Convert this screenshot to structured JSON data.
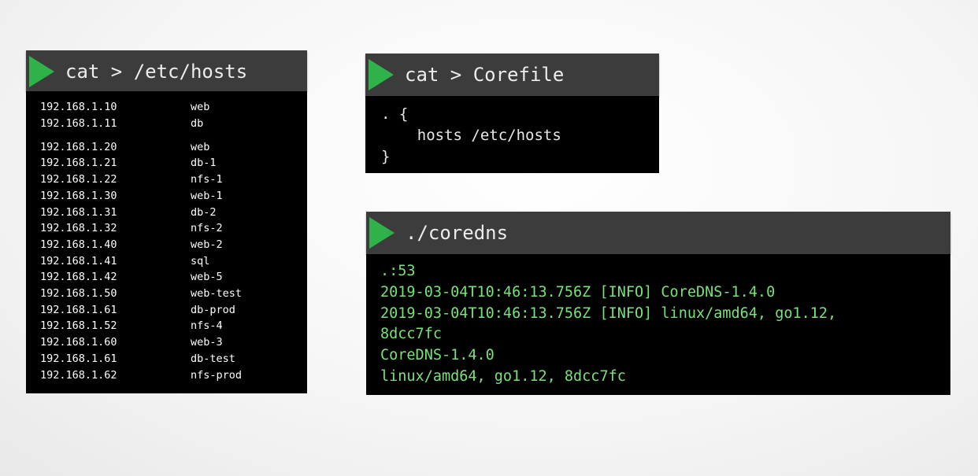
{
  "hosts_panel": {
    "command": "cat > /etc/hosts",
    "entries": [
      {
        "ip": "192.168.1.10",
        "name": "web"
      },
      {
        "ip": "192.168.1.11",
        "name": "db"
      },
      {
        "ip": "192.168.1.20",
        "name": "web"
      },
      {
        "ip": "192.168.1.21",
        "name": "db-1"
      },
      {
        "ip": "192.168.1.22",
        "name": "nfs-1"
      },
      {
        "ip": "192.168.1.30",
        "name": "web-1"
      },
      {
        "ip": "192.168.1.31",
        "name": "db-2"
      },
      {
        "ip": "192.168.1.32",
        "name": "nfs-2"
      },
      {
        "ip": "192.168.1.40",
        "name": "web-2"
      },
      {
        "ip": "192.168.1.41",
        "name": "sql"
      },
      {
        "ip": "192.168.1.42",
        "name": "web-5"
      },
      {
        "ip": "192.168.1.50",
        "name": "web-test"
      },
      {
        "ip": "192.168.1.61",
        "name": "db-prod"
      },
      {
        "ip": "192.168.1.52",
        "name": "nfs-4"
      },
      {
        "ip": "192.168.1.60",
        "name": "web-3"
      },
      {
        "ip": "192.168.1.61",
        "name": "db-test"
      },
      {
        "ip": "192.168.1.62",
        "name": "nfs-prod"
      }
    ]
  },
  "corefile_panel": {
    "command": "cat > Corefile",
    "lines": [
      ". {",
      "    hosts /etc/hosts",
      "}"
    ]
  },
  "coredns_panel": {
    "command": "./coredns",
    "output": [
      ".:53",
      "2019-03-04T10:46:13.756Z [INFO] CoreDNS-1.4.0",
      "2019-03-04T10:46:13.756Z [INFO] linux/amd64, go1.12,",
      "8dcc7fc",
      "CoreDNS-1.4.0",
      "linux/amd64, go1.12, 8dcc7fc"
    ]
  },
  "colors": {
    "play_icon": "#2fb24a",
    "header_bg": "#3c3c3c",
    "terminal_bg": "#000000",
    "hosts_text": "#ffffff",
    "coredns_text": "#78e278"
  }
}
